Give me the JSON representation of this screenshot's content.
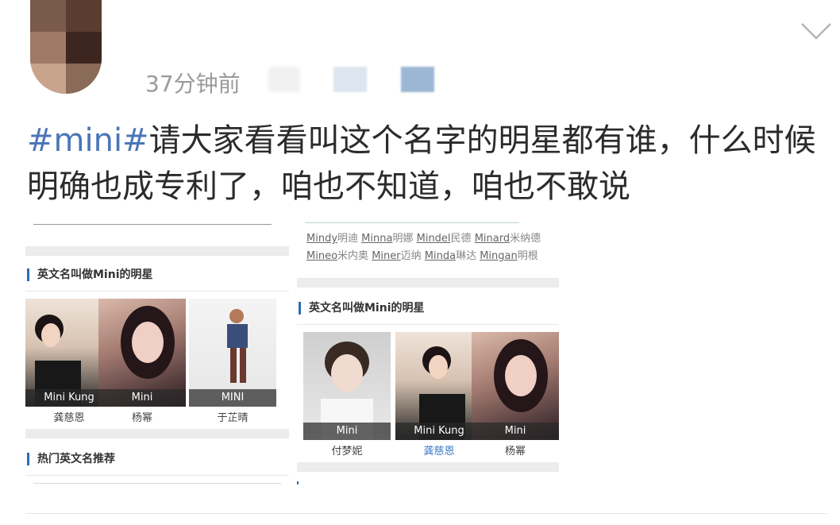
{
  "header": {
    "time": "37分钟前"
  },
  "post": {
    "hashtag": "#mini#",
    "text": "请大家看看叫这个名字的明星都有谁，什么时候明确也成专利了，咱也不知道，咱也不敢说"
  },
  "screenshot": {
    "left_panel": {
      "title": "英文名叫做Mini的明星",
      "footer_title": "热门英文名推荐",
      "cards": [
        {
          "en": "Mini Kung",
          "cn": "龚慈恩"
        },
        {
          "en": "Mini",
          "cn": "杨幂"
        },
        {
          "en": "MINI",
          "cn": "于芷晴"
        }
      ]
    },
    "right_panel": {
      "names_row1": [
        {
          "en": "Mindy",
          "cn": "明迪"
        },
        {
          "en": "Minna",
          "cn": "明娜"
        },
        {
          "en": "Mindel",
          "cn": "民德"
        },
        {
          "en": "Minard",
          "cn": "米纳德"
        }
      ],
      "names_row2": [
        {
          "en": "Mineo",
          "cn": "米内奥"
        },
        {
          "en": "Miner",
          "cn": "迈纳"
        },
        {
          "en": "Minda",
          "cn": "琳达"
        },
        {
          "en": "Mingan",
          "cn": "明根"
        }
      ],
      "title": "英文名叫做Mini的明星",
      "cards": [
        {
          "en": "Mini",
          "cn": "付梦妮"
        },
        {
          "en": "Mini Kung",
          "cn": "龚慈恩"
        },
        {
          "en": "Mini",
          "cn": "杨幂"
        }
      ]
    }
  }
}
